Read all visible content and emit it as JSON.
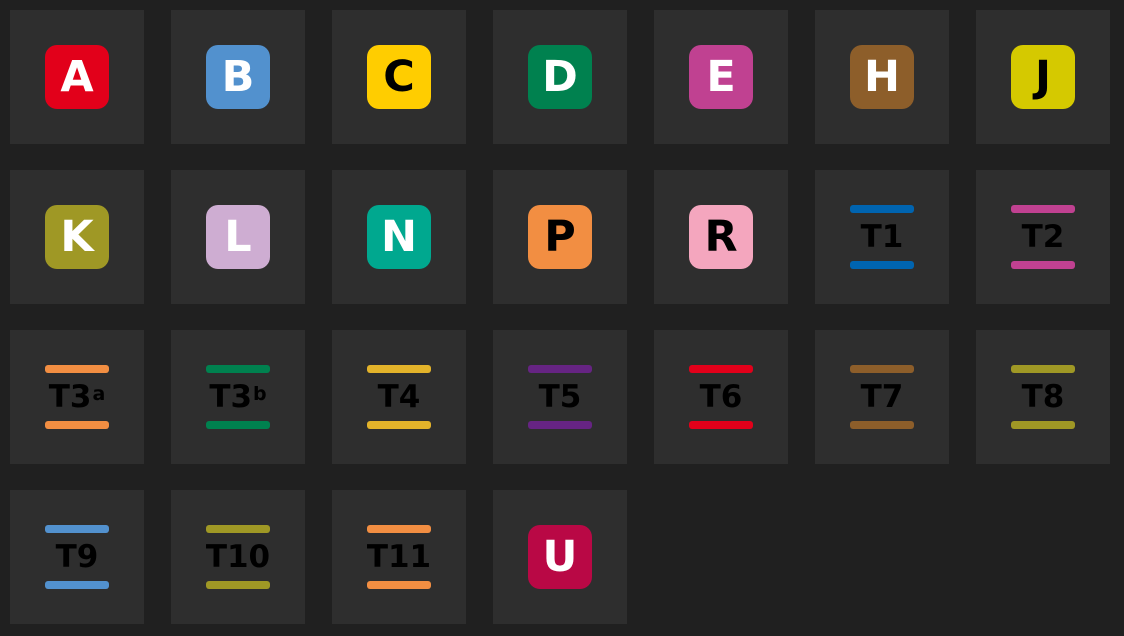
{
  "lines": [
    {
      "type": "metro",
      "label": "A",
      "color": "#e2001a",
      "text_color": "#ffffff"
    },
    {
      "type": "metro",
      "label": "B",
      "color": "#5291ce",
      "text_color": "#ffffff"
    },
    {
      "type": "metro",
      "label": "C",
      "color": "#ffcd00",
      "text_color": "#000000"
    },
    {
      "type": "metro",
      "label": "D",
      "color": "#00814f",
      "text_color": "#ffffff"
    },
    {
      "type": "metro",
      "label": "E",
      "color": "#c04191",
      "text_color": "#ffffff"
    },
    {
      "type": "metro",
      "label": "H",
      "color": "#8d5e2a",
      "text_color": "#ffffff"
    },
    {
      "type": "metro",
      "label": "J",
      "color": "#d5c900",
      "text_color": "#000000"
    },
    {
      "type": "metro",
      "label": "K",
      "color": "#9f9825",
      "text_color": "#ffffff"
    },
    {
      "type": "metro",
      "label": "L",
      "color": "#ceadd2",
      "text_color": "#ffffff"
    },
    {
      "type": "metro",
      "label": "N",
      "color": "#00a88f",
      "text_color": "#ffffff"
    },
    {
      "type": "metro",
      "label": "P",
      "color": "#f28e42",
      "text_color": "#000000"
    },
    {
      "type": "metro",
      "label": "R",
      "color": "#f4a6be",
      "text_color": "#000000"
    },
    {
      "type": "tram",
      "label": "T1",
      "sup": "",
      "color": "#0064b0"
    },
    {
      "type": "tram",
      "label": "T2",
      "sup": "",
      "color": "#c04191"
    },
    {
      "type": "tram",
      "label": "T3",
      "sup": "a",
      "color": "#f28e42"
    },
    {
      "type": "tram",
      "label": "T3",
      "sup": "b",
      "color": "#00814f"
    },
    {
      "type": "tram",
      "label": "T4",
      "sup": "",
      "color": "#e3b32a"
    },
    {
      "type": "tram",
      "label": "T5",
      "sup": "",
      "color": "#662483"
    },
    {
      "type": "tram",
      "label": "T6",
      "sup": "",
      "color": "#e2001a"
    },
    {
      "type": "tram",
      "label": "T7",
      "sup": "",
      "color": "#8d5e2a"
    },
    {
      "type": "tram",
      "label": "T8",
      "sup": "",
      "color": "#9f9825"
    },
    {
      "type": "tram",
      "label": "T9",
      "sup": "",
      "color": "#5291ce"
    },
    {
      "type": "tram",
      "label": "T10",
      "sup": "",
      "color": "#9f9825"
    },
    {
      "type": "tram",
      "label": "T11",
      "sup": "",
      "color": "#f28e42"
    },
    {
      "type": "metro",
      "label": "U",
      "color": "#b90845",
      "text_color": "#ffffff"
    }
  ]
}
